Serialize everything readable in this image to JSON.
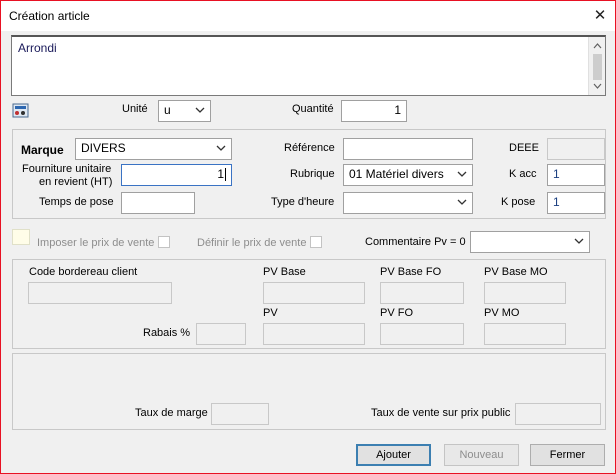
{
  "window": {
    "title": "Création article",
    "close_glyph": "✕"
  },
  "description": {
    "value": "Arrondi"
  },
  "unit": {
    "label": "Unité",
    "value": "u"
  },
  "quantity": {
    "label": "Quantité",
    "value": "1"
  },
  "article": {
    "marque_label": "Marque",
    "marque_value": "DIVERS",
    "reference_label": "Référence",
    "reference_value": "",
    "deee_label": "DEEE",
    "fourniture_label_line1": "Fourniture unitaire",
    "fourniture_label_line2": "en revient (HT)",
    "fourniture_value": "1",
    "rubrique_label": "Rubrique",
    "rubrique_value": "01 Matériel divers",
    "kacc_label": "K acc",
    "kacc_value": "1",
    "temps_label": "Temps de pose",
    "temps_value": "",
    "type_heure_label": "Type d'heure",
    "type_heure_value": "",
    "kpose_label": "K pose",
    "kpose_value": "1"
  },
  "options": {
    "imposer_label": "Imposer le prix de vente",
    "definir_label": "Définir le prix de vente",
    "commentaire_label": "Commentaire Pv = 0",
    "commentaire_value": ""
  },
  "prices": {
    "code_bordereau_label": "Code bordereau client",
    "pv_base_label": "PV Base",
    "pv_base_fo_label": "PV Base FO",
    "pv_base_mo_label": "PV Base MO",
    "pv_label": "PV",
    "pv_fo_label": "PV FO",
    "pv_mo_label": "PV MO",
    "rabais_label": "Rabais %"
  },
  "margins": {
    "taux_marge_label": "Taux de marge",
    "taux_vente_label": "Taux de vente sur prix public"
  },
  "buttons": {
    "ajouter": "Ajouter",
    "nouveau": "Nouveau",
    "fermer": "Fermer"
  },
  "icons": {
    "settings": "calculator-settings-icon",
    "dropdown": "chevron-down-icon"
  }
}
